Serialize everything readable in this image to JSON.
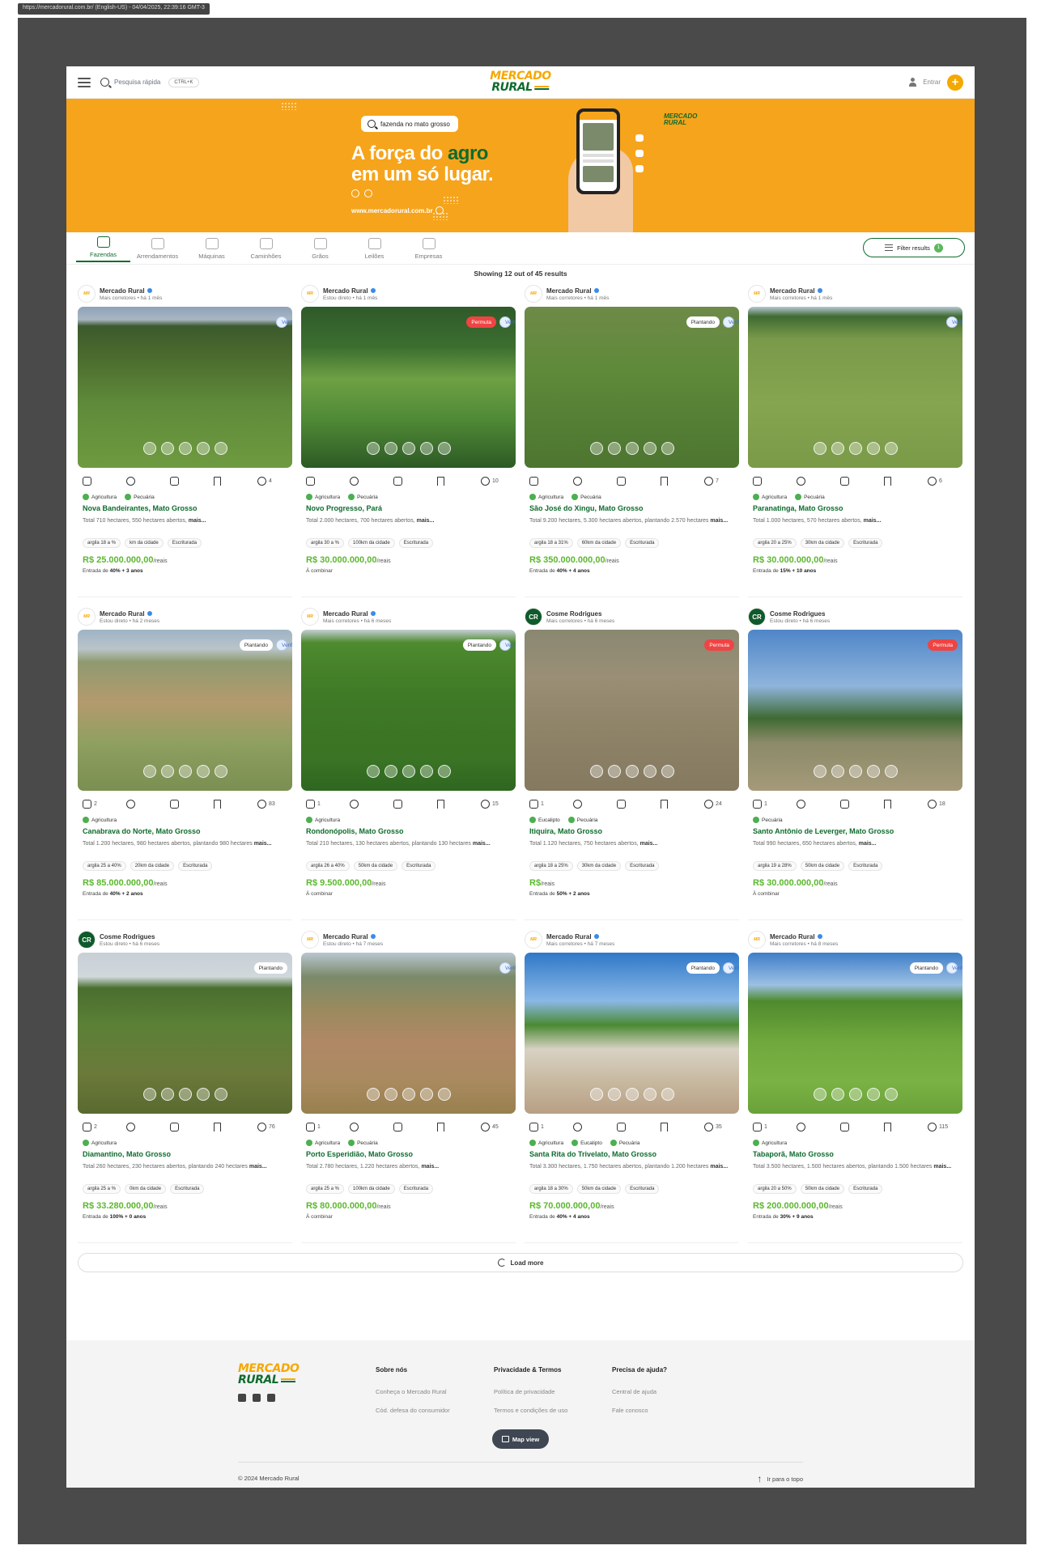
{
  "url_bar": "https://mercadorural.com.br/ (English-US) - 04/04/2025, 22:39:16 GMT-3",
  "header": {
    "search_placeholder": "Pesquisa rápida",
    "shortcut": "CTRL+K",
    "logo_top": "MERCADO",
    "logo_bottom": "RURAL",
    "login": "Entrar"
  },
  "banner": {
    "search_text": "fazenda no mato grosso",
    "slogan_part1": "A força do ",
    "slogan_agro": "agro",
    "slogan_line2": "em um só lugar.",
    "url": "www.mercadorural.com.br",
    "logo_top": "MERCADO",
    "logo_bottom": "RURAL"
  },
  "tabs": [
    "Fazendas",
    "Arrendamentos",
    "Máquinas",
    "Caminhões",
    "Grãos",
    "Leilões",
    "Empresas"
  ],
  "filter": {
    "label": "Filter results",
    "count": "1"
  },
  "showing": "Showing 12 out of 45 results",
  "colors": {
    "brand_green": "#0e6b2d",
    "brand_orange": "#f6a41b",
    "price_green": "#5cb82e",
    "permuta_red": "#ef4444"
  },
  "listings": [
    {
      "seller": "Mercado Rural",
      "verified": true,
      "sub": "Mais corretores • há 1 mês",
      "badges": [
        "Verificada"
      ],
      "likes": "",
      "views": "4",
      "tags": [
        "Agricultura",
        "Pecuária"
      ],
      "title": "Nova Bandeirantes, Mato Grosso",
      "desc": "Total 710 hectares, 550 hectares abertos, ",
      "more": "mais...",
      "chips": [
        "argila 18 a %",
        "km da cidade",
        "Escriturada"
      ],
      "price": "R$ 25.000.000,00",
      "unit": "/reais",
      "terms_pre": "Entrada de ",
      "terms_bold": "40% + 3 anos",
      "terms_plain": "",
      "img": "linear-gradient(180deg,#8fa2b8 0%,#a8b6c2 8%,#3c5a2d 12%,#4a6a2e 30%,#5f8a3a 60%,#6e9a40 100%)"
    },
    {
      "seller": "Mercado Rural",
      "verified": true,
      "sub": "Estou direto • há 1 mês",
      "badges": [
        "Permuta",
        "Verificada"
      ],
      "likes": "",
      "views": "10",
      "tags": [
        "Agricultura",
        "Pecuária"
      ],
      "title": "Novo Progresso, Pará",
      "desc": "Total 2.000 hectares, 700 hectares abertos, ",
      "more": "mais...",
      "chips": [
        "argila 30 a %",
        "100km da cidade",
        "Escriturada"
      ],
      "price": "R$ 30.000.000,00",
      "unit": "/reais",
      "terms_pre": "",
      "terms_bold": "",
      "terms_plain": "À combinar",
      "img": "linear-gradient(180deg,#2f5a2a 0%,#3c6e30 25%,#6ea044 45%,#4f8a36 70%,#2e5a25 100%)"
    },
    {
      "seller": "Mercado Rural",
      "verified": true,
      "sub": "Mais corretores • há 1 mês",
      "badges": [
        "Plantando",
        "Verificada"
      ],
      "likes": "",
      "views": "7",
      "tags": [
        "Agricultura",
        "Pecuária"
      ],
      "title": "São José do Xingu, Mato Grosso",
      "desc": "Total 9.200 hectares, 5.300 hectares abertos, plantando 2.570 hectares ",
      "more": "mais...",
      "chips": [
        "argila 18 a 31%",
        "60km da cidade",
        "Escriturada"
      ],
      "price": "R$ 350.000.000,00",
      "unit": "/reais",
      "terms_pre": "Entrada de ",
      "terms_bold": "40% + 4 anos",
      "terms_plain": "",
      "img": "linear-gradient(180deg,#6e8a48 0%,#5f8a3a 40%,#557f35 70%,#4d7530 100%)"
    },
    {
      "seller": "Mercado Rural",
      "verified": true,
      "sub": "Mais corretores • há 1 mês",
      "badges": [
        "Verificada"
      ],
      "likes": "",
      "views": "6",
      "tags": [
        "Agricultura",
        "Pecuária"
      ],
      "title": "Paranatinga, Mato Grosso",
      "desc": "Total 1.000 hectares, 570 hectares abertos, ",
      "more": "mais...",
      "chips": [
        "argila 20 a 25%",
        "30km da cidade",
        "Escriturada"
      ],
      "price": "R$ 30.000.000,00",
      "unit": "/reais",
      "terms_pre": "Entrada de ",
      "terms_bold": "15% + 10 anos",
      "terms_plain": "",
      "img": "linear-gradient(180deg,#b6c7d2 0%,#3f6a32 6%,#7a9a4a 20%,#86a550 60%,#7a9a48 100%)"
    },
    {
      "seller": "Mercado Rural",
      "verified": true,
      "sub": "Estou direto • há 2 meses",
      "badges": [
        "Plantando",
        "Verificada"
      ],
      "likes": "2",
      "views": "83",
      "tags": [
        "Agricultura"
      ],
      "title": "Canabrava do Norte, Mato Grosso",
      "desc": "Total 1.200 hectares, 980 hectares abertos, plantando 980 hectares ",
      "more": "mais...",
      "chips": [
        "argila 25 a 40%",
        "20km da cidade",
        "Escriturada"
      ],
      "price": "R$ 85.000.000,00",
      "unit": "/reais",
      "terms_pre": "Entrada de ",
      "terms_bold": "40% + 2 anos",
      "terms_plain": "",
      "img": "linear-gradient(180deg,#9fb3c6 0%,#b9c4c8 12%,#8f9a70 20%,#b49a6e 45%,#8fa060 70%,#7a8f52 100%)"
    },
    {
      "seller": "Mercado Rural",
      "verified": true,
      "sub": "Mais corretores • há 6 meses",
      "badges": [
        "Plantando",
        "Verificada"
      ],
      "likes": "1",
      "views": "15",
      "tags": [
        "Agricultura"
      ],
      "title": "Rondonópolis, Mato Grosso",
      "desc": "Total 210 hectares, 130 hectares abertos, plantando 130 hectares ",
      "more": "mais...",
      "chips": [
        "argila 26 a 40%",
        "50km da cidade",
        "Escriturada"
      ],
      "price": "R$ 9.500.000,00",
      "unit": "/reais",
      "terms_pre": "",
      "terms_bold": "",
      "terms_plain": "À combinar",
      "img": "linear-gradient(180deg,#c5cfd6 0%,#4e8a2e 8%,#3f7a26 40%,#3a7424 80%,#2e6620 100%)"
    },
    {
      "seller": "Cosme Rodrigues",
      "verified": false,
      "sub": "Mais corretores • há 6 meses",
      "badges": [
        "Permuta"
      ],
      "likes": "1",
      "views": "24",
      "tags": [
        "Eucalipto",
        "Pecuária"
      ],
      "title": "Itiquira, Mato Grosso",
      "desc": "Total 1.120 hectares, 750 hectares abertos, ",
      "more": "mais...",
      "chips": [
        "argila 18 a 25%",
        "30km da cidade",
        "Escriturada"
      ],
      "price": "R$",
      "unit": "/reais",
      "terms_pre": "Entrada de ",
      "terms_bold": "50% + 2 anos",
      "terms_plain": "",
      "img": "linear-gradient(180deg,#8a8872 0%,#9a8f76 30%,#8f8468 60%,#857a60 100%)"
    },
    {
      "seller": "Cosme Rodrigues",
      "verified": false,
      "sub": "Estou direto • há 6 meses",
      "badges": [
        "Permuta"
      ],
      "likes": "1",
      "views": "18",
      "tags": [
        "Pecuária"
      ],
      "title": "Santo Antônio de Leverger, Mato Grosso",
      "desc": "Total 990 hectares, 650 hectares abertos, ",
      "more": "mais...",
      "chips": [
        "argila 19 a 28%",
        "50km da cidade",
        "Escriturada"
      ],
      "price": "R$ 30.000.000,00",
      "unit": "/reais",
      "terms_pre": "",
      "terms_bold": "",
      "terms_plain": "À combinar",
      "img": "linear-gradient(180deg,#4f86c8 0%,#8fb4dc 35%,#3f6a32 55%,#8b8a68 70%,#a59a7a 100%)"
    },
    {
      "seller": "Cosme Rodrigues",
      "verified": false,
      "sub": "Estou direto • há 6 meses",
      "badges": [
        "Plantando"
      ],
      "likes": "2",
      "views": "76",
      "tags": [
        "Agricultura"
      ],
      "title": "Diamantino, Mato Grosso",
      "desc": "Total 260 hectares, 230 hectares abertos, plantando 240 hectares ",
      "more": "mais...",
      "chips": [
        "argila 25 a %",
        "0km da cidade",
        "Escriturada"
      ],
      "price": "R$ 33.280.000,00",
      "unit": "/reais",
      "terms_pre": "Entrada de ",
      "terms_bold": "100% + 0 anos",
      "terms_plain": "",
      "img": "linear-gradient(180deg,#c8d0d6 0%,#d0d8dc 15%,#4a6e2e 22%,#5b8036 45%,#6b7a3a 75%,#5a6a30 100%)"
    },
    {
      "seller": "Mercado Rural",
      "verified": true,
      "sub": "Estou direto • há 7 meses",
      "badges": [
        "Verificada"
      ],
      "likes": "1",
      "views": "45",
      "tags": [
        "Agricultura",
        "Pecuária"
      ],
      "title": "Porto Esperidião, Mato Grosso",
      "desc": "Total 2.780 hectares, 1.220 hectares abertos, ",
      "more": "mais...",
      "chips": [
        "argila 25 a %",
        "100km da cidade",
        "Escriturada"
      ],
      "price": "R$ 80.000.000,00",
      "unit": "/reais",
      "terms_pre": "",
      "terms_bold": "",
      "terms_plain": "À combinar",
      "img": "linear-gradient(180deg,#b9c6d0 0%,#7a8a6a 15%,#9a8a5e 35%,#b08866 55%,#a98a60 80%,#98804e 100%)"
    },
    {
      "seller": "Mercado Rural",
      "verified": true,
      "sub": "Mais corretores • há 7 meses",
      "badges": [
        "Plantando",
        "Verificada"
      ],
      "likes": "1",
      "views": "35",
      "tags": [
        "Agricultura",
        "Eucalipto",
        "Pecuária"
      ],
      "title": "Santa Rita do Trivelato, Mato Grosso",
      "desc": "Total 3.300 hectares, 1.750 hectares abertos, plantando 1.200 hectares ",
      "more": "mais...",
      "chips": [
        "argila 18 a 30%",
        "50km da cidade",
        "Escriturada"
      ],
      "price": "R$ 70.000.000,00",
      "unit": "/reais",
      "terms_pre": "Entrada de ",
      "terms_bold": "40% + 4 anos",
      "terms_plain": "",
      "img": "linear-gradient(180deg,#2f78c8 0%,#8ab8e6 30%,#4a8a32 45%,#d8d2c4 60%,#c7b9a0 80%,#b89f84 100%)"
    },
    {
      "seller": "Mercado Rural",
      "verified": true,
      "sub": "Mais corretores • há 8 meses",
      "badges": [
        "Plantando",
        "Verificada"
      ],
      "likes": "1",
      "views": "115",
      "tags": [
        "Agricultura"
      ],
      "title": "Tabaporã, Mato Grosso",
      "desc": "Total 3.500 hectares, 1.500 hectares abertos, plantando 1.500 hectares ",
      "more": "mais...",
      "chips": [
        "argila 20 a 50%",
        "50km da cidade",
        "Escriturada"
      ],
      "price": "R$ 200.000.000,00",
      "unit": "/reais",
      "terms_pre": "Entrada de ",
      "terms_bold": "30% + 9 anos",
      "terms_plain": "",
      "img": "linear-gradient(180deg,#3f7ec8 0%,#9cc0e4 20%,#4f8a2e 30%,#6fa83c 55%,#7ab244 80%,#6aa23a 100%)"
    }
  ],
  "load_more": "Load more",
  "footer": {
    "logo_top": "MERCADO",
    "logo_bottom": "RURAL",
    "col1_title": "Sobre nós",
    "col1_links": [
      "Conheça o Mercado Rural",
      "Cód. defesa do consumidor"
    ],
    "col2_title": "Privacidade & Termos",
    "col2_links": [
      "Política de privacidade",
      "Termos e condições de uso"
    ],
    "col3_title": "Precisa de ajuda?",
    "col3_links": [
      "Central de ajuda",
      "Fale conosco"
    ],
    "map_view": "Map view",
    "copyright": "© 2024 Mercado Rural",
    "back_top": "Ir para o topo"
  }
}
